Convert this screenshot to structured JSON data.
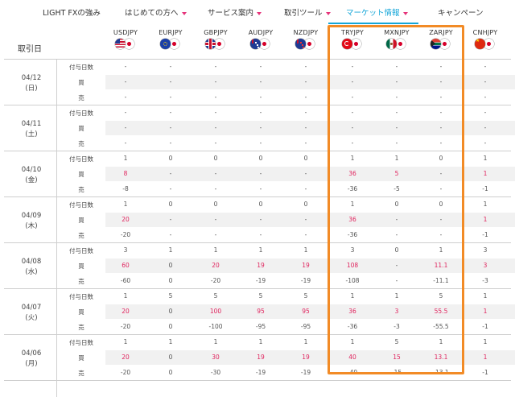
{
  "nav": {
    "items": [
      {
        "label": "LIGHT FXの強み",
        "dropdown": false,
        "active": false
      },
      {
        "label": "はじめての方へ",
        "dropdown": true,
        "active": false
      },
      {
        "label": "サービス案内",
        "dropdown": true,
        "active": false
      },
      {
        "label": "取引ツール",
        "dropdown": true,
        "active": false
      },
      {
        "label": "マーケット情報",
        "dropdown": true,
        "active": true
      },
      {
        "label": "キャンペーン",
        "dropdown": false,
        "active": false
      }
    ]
  },
  "table": {
    "date_header": "取引日",
    "currencies": [
      {
        "code": "USDJPY",
        "flags": [
          "usd-flag-icon",
          "jpy-flag-icon"
        ]
      },
      {
        "code": "EURJPY",
        "flags": [
          "eur-flag-icon",
          "jpy-flag-icon"
        ]
      },
      {
        "code": "GBPJPY",
        "flags": [
          "gbp-flag-icon",
          "jpy-flag-icon"
        ]
      },
      {
        "code": "AUDJPY",
        "flags": [
          "aud-flag-icon",
          "jpy-flag-icon"
        ]
      },
      {
        "code": "NZDJPY",
        "flags": [
          "nzd-flag-icon",
          "jpy-flag-icon"
        ]
      },
      {
        "code": "TRYJPY",
        "flags": [
          "try-flag-icon",
          "jpy-flag-icon"
        ]
      },
      {
        "code": "MXNJPY",
        "flags": [
          "mxn-flag-icon",
          "jpy-flag-icon"
        ]
      },
      {
        "code": "ZARJPY",
        "flags": [
          "zar-flag-icon",
          "jpy-flag-icon"
        ]
      },
      {
        "code": "CNHJPY",
        "flags": [
          "cnh-flag-icon",
          "jpy-flag-icon"
        ]
      }
    ],
    "row_labels": {
      "days": "付与日数",
      "buy": "買",
      "sell": "売"
    },
    "groups": [
      {
        "date": "04/12",
        "weekday": "(日)",
        "days": [
          "-",
          "-",
          "-",
          "-",
          "-",
          "-",
          "-",
          "-",
          "-"
        ],
        "buy": [
          "-",
          "-",
          "-",
          "-",
          "-",
          "-",
          "-",
          "-",
          "-"
        ],
        "sell": [
          "-",
          "-",
          "-",
          "-",
          "-",
          "-",
          "-",
          "-",
          "-"
        ]
      },
      {
        "date": "04/11",
        "weekday": "(土)",
        "days": [
          "-",
          "-",
          "-",
          "-",
          "-",
          "-",
          "-",
          "-",
          "-"
        ],
        "buy": [
          "-",
          "-",
          "-",
          "-",
          "-",
          "-",
          "-",
          "-",
          "-"
        ],
        "sell": [
          "-",
          "-",
          "-",
          "-",
          "-",
          "-",
          "-",
          "-",
          "-"
        ]
      },
      {
        "date": "04/10",
        "weekday": "(金)",
        "days": [
          "1",
          "0",
          "0",
          "0",
          "0",
          "1",
          "1",
          "0",
          "1"
        ],
        "buy": [
          "8",
          "-",
          "-",
          "-",
          "-",
          "36",
          "5",
          "-",
          "1"
        ],
        "sell": [
          "-8",
          "-",
          "-",
          "-",
          "-",
          "-36",
          "-5",
          "-",
          "-1"
        ]
      },
      {
        "date": "04/09",
        "weekday": "(木)",
        "days": [
          "1",
          "0",
          "0",
          "0",
          "0",
          "1",
          "0",
          "0",
          "1"
        ],
        "buy": [
          "20",
          "-",
          "-",
          "-",
          "-",
          "36",
          "-",
          "-",
          "1"
        ],
        "sell": [
          "-20",
          "-",
          "-",
          "-",
          "-",
          "-36",
          "-",
          "-",
          "-1"
        ]
      },
      {
        "date": "04/08",
        "weekday": "(水)",
        "days": [
          "3",
          "1",
          "1",
          "1",
          "1",
          "3",
          "0",
          "1",
          "3"
        ],
        "buy": [
          "60",
          "0",
          "20",
          "19",
          "19",
          "108",
          "-",
          "11.1",
          "3"
        ],
        "sell": [
          "-60",
          "0",
          "-20",
          "-19",
          "-19",
          "-108",
          "-",
          "-11.1",
          "-3"
        ]
      },
      {
        "date": "04/07",
        "weekday": "(火)",
        "days": [
          "1",
          "5",
          "5",
          "5",
          "5",
          "1",
          "1",
          "5",
          "1"
        ],
        "buy": [
          "20",
          "0",
          "100",
          "95",
          "95",
          "36",
          "3",
          "55.5",
          "1"
        ],
        "sell": [
          "-20",
          "0",
          "-100",
          "-95",
          "-95",
          "-36",
          "-3",
          "-55.5",
          "-1"
        ]
      },
      {
        "date": "04/06",
        "weekday": "(月)",
        "days": [
          "1",
          "1",
          "1",
          "1",
          "1",
          "1",
          "5",
          "1",
          "1"
        ],
        "buy": [
          "20",
          "0",
          "30",
          "19",
          "19",
          "40",
          "15",
          "13.1",
          "1"
        ],
        "sell": [
          "-20",
          "0",
          "-30",
          "-19",
          "-19",
          "-40",
          "-15",
          "-13.1",
          "-1"
        ]
      }
    ]
  },
  "colors": {
    "accent": "#14a6d8",
    "buy": "#e0245e",
    "highlight": "#f28b26",
    "nav_arrow": "#e6337a"
  }
}
